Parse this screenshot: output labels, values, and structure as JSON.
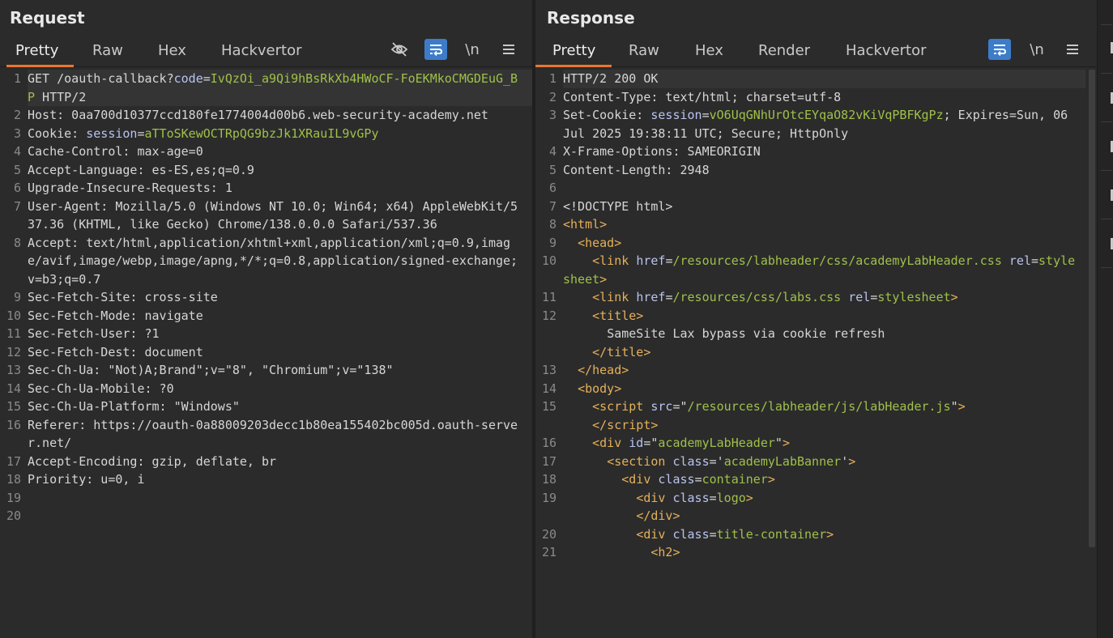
{
  "request": {
    "title": "Request",
    "tabs": [
      "Pretty",
      "Raw",
      "Hex",
      "Hackvertor"
    ],
    "active_tab": "Pretty",
    "icons": [
      "eye-slash-icon",
      "wrap-icon",
      "newline-icon",
      "menu-icon"
    ],
    "newline_label": "\\n",
    "lines": [
      {
        "n": "1",
        "html": "GET /oauth-callback?<span class='attr'>code</span>=<span class='val'>IvQzOi_a9Qi9hBsRkXb4HWoCF-FoEKMkoCMGDEuG_BP</span> HTTP/2"
      },
      {
        "n": "2",
        "html": "Host: 0aa700d10377ccd180fe1774004d00b6.web-security-academy.net"
      },
      {
        "n": "3",
        "html": "Cookie: <span class='attr'>session</span>=<span class='val'>aTToSKewOCTRpQG9bzJk1XRauIL9vGPy</span>"
      },
      {
        "n": "4",
        "html": "Cache-Control: max-age=0"
      },
      {
        "n": "5",
        "html": "Accept-Language: es-ES,es;q=0.9"
      },
      {
        "n": "6",
        "html": "Upgrade-Insecure-Requests: 1"
      },
      {
        "n": "7",
        "html": "User-Agent: Mozilla/5.0 (Windows NT 10.0; Win64; x64) AppleWebKit/537.36 (KHTML, like Gecko) Chrome/138.0.0.0 Safari/537.36"
      },
      {
        "n": "8",
        "html": "Accept: text/html,application/xhtml+xml,application/xml;q=0.9,image/avif,image/webp,image/apng,*/*;q=0.8,application/signed-exchange;v=b3;q=0.7"
      },
      {
        "n": "9",
        "html": "Sec-Fetch-Site: cross-site"
      },
      {
        "n": "10",
        "html": "Sec-Fetch-Mode: navigate"
      },
      {
        "n": "11",
        "html": "Sec-Fetch-User: ?1"
      },
      {
        "n": "12",
        "html": "Sec-Fetch-Dest: document"
      },
      {
        "n": "13",
        "html": "Sec-Ch-Ua: \"Not)A;Brand\";v=\"8\", \"Chromium\";v=\"138\""
      },
      {
        "n": "14",
        "html": "Sec-Ch-Ua-Mobile: ?0"
      },
      {
        "n": "15",
        "html": "Sec-Ch-Ua-Platform: \"Windows\""
      },
      {
        "n": "16",
        "html": "Referer: https://oauth-0a88009203decc1b80ea155402bc005d.oauth-server.net/"
      },
      {
        "n": "17",
        "html": "Accept-Encoding: gzip, deflate, br"
      },
      {
        "n": "18",
        "html": "Priority: u=0, i"
      },
      {
        "n": "19",
        "html": ""
      },
      {
        "n": "20",
        "html": ""
      }
    ]
  },
  "response": {
    "title": "Response",
    "tabs": [
      "Pretty",
      "Raw",
      "Hex",
      "Render",
      "Hackvertor"
    ],
    "active_tab": "Pretty",
    "icons": [
      "wrap-icon",
      "newline-icon",
      "menu-icon"
    ],
    "newline_label": "\\n",
    "lines": [
      {
        "n": "1",
        "html": "HTTP/2 200 OK"
      },
      {
        "n": "2",
        "html": "Content-Type: text/html; charset=utf-8"
      },
      {
        "n": "3",
        "html": "Set-Cookie: <span class='attr'>session</span>=<span class='val'>vO6UqGNhUrOtcEYqaO82vKiVqPBFKgPz</span>; Expires=Sun, 06 Jul 2025 19:38:11 UTC; Secure; HttpOnly"
      },
      {
        "n": "4",
        "html": "X-Frame-Options: SAMEORIGIN"
      },
      {
        "n": "5",
        "html": "Content-Length: 2948"
      },
      {
        "n": "6",
        "html": ""
      },
      {
        "n": "7",
        "html": "&lt;!DOCTYPE html&gt;"
      },
      {
        "n": "8",
        "html": "<span class='tag'>&lt;html&gt;</span>"
      },
      {
        "n": "9",
        "html": "  <span class='tag'>&lt;head&gt;</span>"
      },
      {
        "n": "10",
        "html": "    <span class='tag'>&lt;link</span> <span class='attr'>href</span>=<span class='str'>/resources/labheader/css/academyLabHeader.css</span> <span class='attr'>rel</span>=<span class='str'>stylesheet</span><span class='tag'>&gt;</span>"
      },
      {
        "n": "11",
        "html": "    <span class='tag'>&lt;link</span> <span class='attr'>href</span>=<span class='str'>/resources/css/labs.css</span> <span class='attr'>rel</span>=<span class='str'>stylesheet</span><span class='tag'>&gt;</span>"
      },
      {
        "n": "12",
        "html": "    <span class='tag'>&lt;title&gt;</span>\n      SameSite Lax bypass via cookie refresh\n    <span class='tag'>&lt;/title&gt;</span>"
      },
      {
        "n": "13",
        "html": "  <span class='tag'>&lt;/head&gt;</span>"
      },
      {
        "n": "14",
        "html": "  <span class='tag'>&lt;body&gt;</span>"
      },
      {
        "n": "15",
        "html": "    <span class='tag'>&lt;script</span> <span class='attr'>src</span>=\"<span class='str'>/resources/labheader/js/labHeader.js</span>\"<span class='tag'>&gt;</span>\n    <span class='tag'>&lt;/script&gt;</span>"
      },
      {
        "n": "16",
        "html": "    <span class='tag'>&lt;div</span> <span class='attr'>id</span>=\"<span class='str'>academyLabHeader</span>\"<span class='tag'>&gt;</span>"
      },
      {
        "n": "17",
        "html": "      <span class='tag'>&lt;section</span> <span class='attr'>class</span>='<span class='str'>academyLabBanner</span>'<span class='tag'>&gt;</span>"
      },
      {
        "n": "18",
        "html": "        <span class='tag'>&lt;div</span> <span class='attr'>class</span>=<span class='str'>container</span><span class='tag'>&gt;</span>"
      },
      {
        "n": "19",
        "html": "          <span class='tag'>&lt;div</span> <span class='attr'>class</span>=<span class='str'>logo</span><span class='tag'>&gt;</span>\n          <span class='tag'>&lt;/div&gt;</span>"
      },
      {
        "n": "20",
        "html": "          <span class='tag'>&lt;div</span> <span class='attr'>class</span>=<span class='str'>title-container</span><span class='tag'>&gt;</span>"
      },
      {
        "n": "21",
        "html": "            <span class='tag'>&lt;h2&gt;</span>"
      }
    ]
  },
  "colors": {
    "accent": "#e8762d",
    "active_button": "#3d7cc9",
    "value": "#9fc04a",
    "attr": "#b9c3f0",
    "tag": "#e5b05a"
  }
}
